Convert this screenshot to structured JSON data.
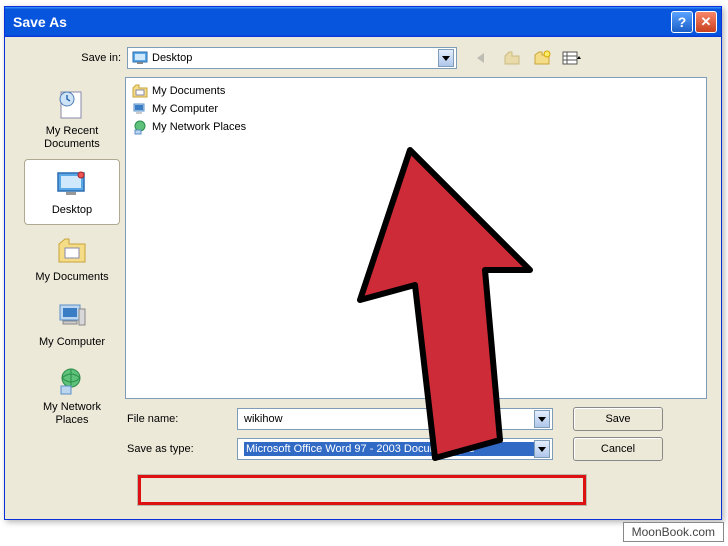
{
  "dialog": {
    "title": "Save As",
    "save_in_label": "Save in:",
    "save_in_value": "Desktop",
    "file_name_label": "File name:",
    "file_name_value": "wikihow",
    "save_type_label": "Save as type:",
    "save_type_value": "Microsoft Office Word 97 - 2003 Document (*.d",
    "save_button": "Save",
    "cancel_button": "Cancel"
  },
  "places": [
    {
      "label": "My Recent Documents",
      "selected": false
    },
    {
      "label": "Desktop",
      "selected": true
    },
    {
      "label": "My Documents",
      "selected": false
    },
    {
      "label": "My Computer",
      "selected": false
    },
    {
      "label": "My Network Places",
      "selected": false
    }
  ],
  "files": [
    {
      "name": "My Documents"
    },
    {
      "name": "My Computer"
    },
    {
      "name": "My Network Places"
    }
  ],
  "watermark": "MoonBook.com"
}
